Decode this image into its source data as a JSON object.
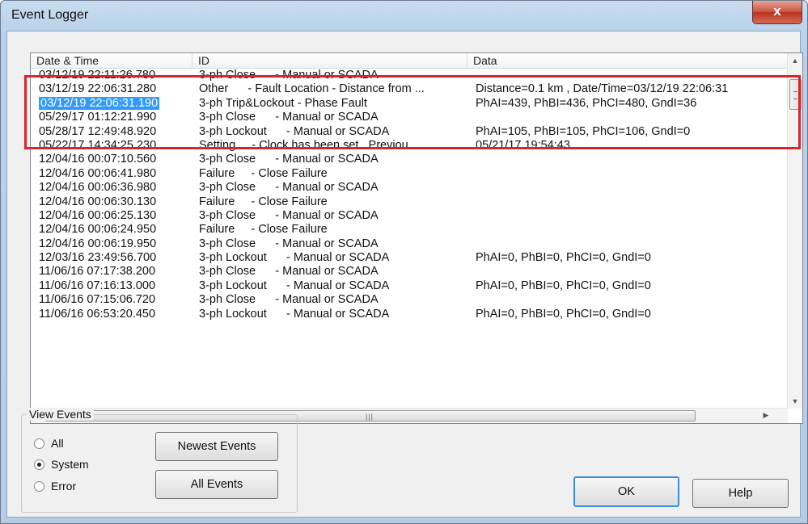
{
  "window": {
    "title": "Event Logger",
    "close_label": "x"
  },
  "columns": [
    "Date & Time",
    "ID",
    "Data"
  ],
  "rows": [
    {
      "time": "03/12/19 22:11:26.780",
      "id": "3-ph Close      - Manual or SCADA",
      "data": ""
    },
    {
      "time": "03/12/19 22:06:31.280",
      "id": "Other      - Fault Location - Distance from ...",
      "data": "Distance=0.1 km , Date/Time=03/12/19 22:06:31"
    },
    {
      "time": "03/12/19 22:06:31.190",
      "id": "3-ph Trip&Lockout - Phase Fault",
      "data": "PhAI=439, PhBI=436, PhCI=480, GndI=36",
      "selected": true
    },
    {
      "time": "05/29/17 01:12:21.990",
      "id": "3-ph Close      - Manual or SCADA",
      "data": ""
    },
    {
      "time": "05/28/17 12:49:48.920",
      "id": "3-ph Lockout      - Manual or SCADA",
      "data": "PhAI=105, PhBI=105, PhCI=106, GndI=0"
    },
    {
      "time": "05/22/17 14:34:25.230",
      "id": "Setting     - Clock has been set.  Previou...",
      "data": "05/21/17 19:54:43"
    },
    {
      "time": "12/04/16 00:07:10.560",
      "id": "3-ph Close      - Manual or SCADA",
      "data": ""
    },
    {
      "time": "12/04/16 00:06:41.980",
      "id": "Failure     - Close Failure",
      "data": ""
    },
    {
      "time": "12/04/16 00:06:36.980",
      "id": "3-ph Close      - Manual or SCADA",
      "data": ""
    },
    {
      "time": "12/04/16 00:06:30.130",
      "id": "Failure     - Close Failure",
      "data": ""
    },
    {
      "time": "12/04/16 00:06:25.130",
      "id": "3-ph Close      - Manual or SCADA",
      "data": ""
    },
    {
      "time": "12/04/16 00:06:24.950",
      "id": "Failure     - Close Failure",
      "data": ""
    },
    {
      "time": "12/04/16 00:06:19.950",
      "id": "3-ph Close      - Manual or SCADA",
      "data": ""
    },
    {
      "time": "12/03/16 23:49:56.700",
      "id": "3-ph Lockout      - Manual or SCADA",
      "data": "PhAI=0, PhBI=0, PhCI=0, GndI=0"
    },
    {
      "time": "11/06/16 07:17:38.200",
      "id": "3-ph Close      - Manual or SCADA",
      "data": ""
    },
    {
      "time": "11/06/16 07:16:13.000",
      "id": "3-ph Lockout      - Manual or SCADA",
      "data": "PhAI=0, PhBI=0, PhCI=0, GndI=0"
    },
    {
      "time": "11/06/16 07:15:06.720",
      "id": "3-ph Close      - Manual or SCADA",
      "data": ""
    },
    {
      "time": "11/06/16 06:53:20.450",
      "id": "3-ph Lockout      - Manual or SCADA",
      "data": "PhAI=0, PhBI=0, PhCI=0, GndI=0"
    }
  ],
  "view_events": {
    "label": "View Events",
    "options": [
      {
        "label": "All",
        "checked": false
      },
      {
        "label": "System",
        "checked": true
      },
      {
        "label": "Error",
        "checked": false
      }
    ],
    "newest_button": "Newest Events",
    "all_button": "All Events"
  },
  "buttons": {
    "ok": "OK",
    "help": "Help"
  },
  "colors": {
    "selection": "#3399ff",
    "highlight_box": "#d9232d",
    "close_button": "#c9513f"
  }
}
